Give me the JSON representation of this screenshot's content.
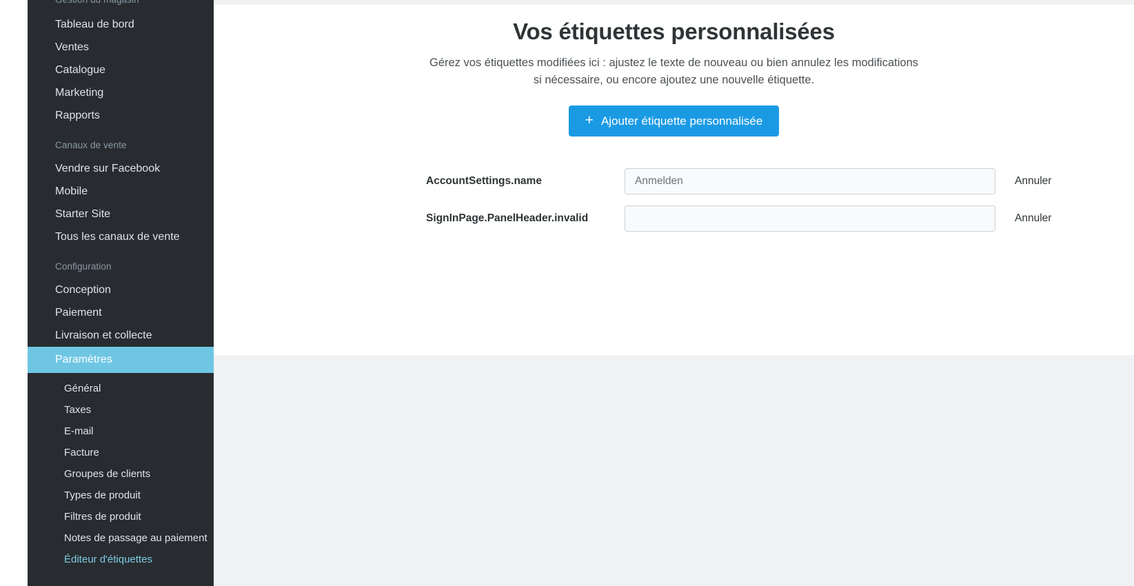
{
  "sidebar": {
    "sections": [
      {
        "title": "Gestion du magasin",
        "clipped": true,
        "items": [
          {
            "label": "Tableau de bord"
          },
          {
            "label": "Ventes"
          },
          {
            "label": "Catalogue"
          },
          {
            "label": "Marketing"
          },
          {
            "label": "Rapports"
          }
        ]
      },
      {
        "title": "Canaux de vente",
        "items": [
          {
            "label": "Vendre sur Facebook"
          },
          {
            "label": "Mobile"
          },
          {
            "label": "Starter Site"
          },
          {
            "label": "Tous les canaux de vente"
          }
        ]
      },
      {
        "title": "Configuration",
        "items": [
          {
            "label": "Conception"
          },
          {
            "label": "Paiement"
          },
          {
            "label": "Livraison et collecte"
          },
          {
            "label": "Paramètres",
            "active": true
          }
        ]
      }
    ],
    "subitems": [
      {
        "label": "Général"
      },
      {
        "label": "Taxes"
      },
      {
        "label": "E-mail"
      },
      {
        "label": "Facture"
      },
      {
        "label": "Groupes de clients"
      },
      {
        "label": "Types de produit"
      },
      {
        "label": "Filtres de produit"
      },
      {
        "label": "Notes de passage au paiement"
      },
      {
        "label": "Éditeur d'étiquettes",
        "current": true
      }
    ],
    "colors": {
      "background": "#282c30",
      "active_background": "#6fc6e3",
      "current_text": "#7fcbe6",
      "section_title_text": "#8a98a5",
      "item_text": "#dfe3e7"
    }
  },
  "main": {
    "title": "Vos étiquettes personnalisées",
    "subtitle": "Gérez vos étiquettes modifiées ici : ajustez le texte de nouveau ou bien annulez les modifications si nécessaire, ou encore ajoutez une nouvelle étiquette.",
    "add_button": {
      "icon": "plus-icon",
      "plus_glyph": "+",
      "label": "Ajouter étiquette personnalisée",
      "color": "#1b9ae4"
    },
    "rows": [
      {
        "key": "AccountSettings.name",
        "value": "",
        "placeholder": "Anmelden",
        "cancel_label": "Annuler"
      },
      {
        "key": "SignInPage.PanelHeader.invalid",
        "value": "",
        "placeholder": "",
        "cancel_label": "Annuler"
      }
    ],
    "colors": {
      "panel_background": "#ffffff",
      "page_background": "#f0f1f2",
      "input_background": "#f9fafb",
      "input_border": "#ccd0d4"
    }
  }
}
